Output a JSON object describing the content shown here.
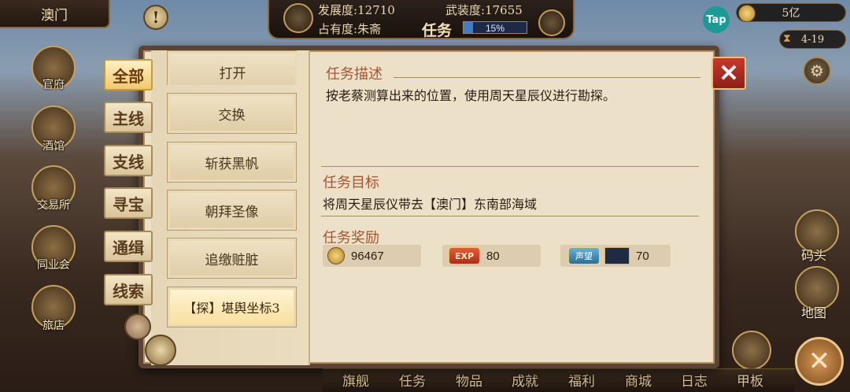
{
  "top": {
    "location": "澳门",
    "development_label": "发展度:",
    "development_value": "12710",
    "armament_label": "武装度:",
    "armament_value": "17655",
    "occupancy_label": "占有度:",
    "occupancy_holder": "朱斋",
    "task_label": "任务",
    "progress_text": "15%",
    "progress_fraction": 0.15,
    "tap": "Tap",
    "money": "5亿",
    "date": "4-19"
  },
  "left_menu": [
    "官府",
    "酒馆",
    "交易所",
    "同业会",
    "旅店"
  ],
  "right_menu": [
    "码头",
    "地图"
  ],
  "bottom_nav": [
    "旗舰",
    "任务",
    "物品",
    "成就",
    "福利",
    "商城",
    "日志",
    "甲板"
  ],
  "categories": [
    "全部",
    "主线",
    "支线",
    "寻宝",
    "通缉",
    "线索"
  ],
  "quests": [
    "打开",
    "交换",
    "斩获黑帆",
    "朝拜圣像",
    "追缴赃脏",
    "【探】堪舆坐标3"
  ],
  "detail": {
    "desc_title": "任务描述",
    "desc_text": "按老蔡测算出来的位置，使用周天星辰仪进行勘探。",
    "goal_title": "任务目标",
    "goal_text": "将周天星辰仪带去【澳门】东南部海域",
    "reward_title": "任务奖励",
    "reward_money": "96467",
    "exp_label": "EXP",
    "reward_exp": "80",
    "fame_label": "声望",
    "reward_fame": "70"
  },
  "colors": {
    "title_red": "#a8542c",
    "tab_active": "#f2c96d",
    "close_red": "#c9372a"
  }
}
